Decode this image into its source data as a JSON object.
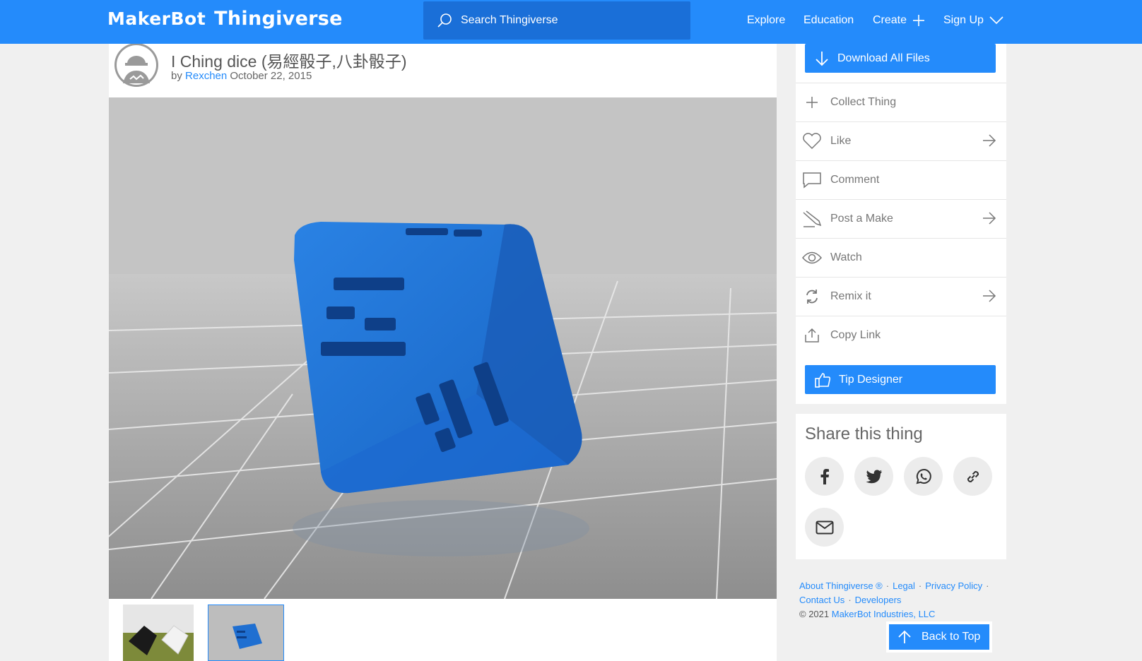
{
  "brand": {
    "maker": "MakerBot",
    "thingiverse": "Thingiverse"
  },
  "search": {
    "placeholder": "Search Thingiverse"
  },
  "nav": {
    "explore": "Explore",
    "education": "Education",
    "create": "Create",
    "signup": "Sign Up"
  },
  "thing": {
    "title": "I Ching dice (易經骰子,八卦骰子)",
    "by": "by",
    "author": "Rexchen",
    "date": "October 22, 2015"
  },
  "actions": {
    "download": "Download All Files",
    "collect": "Collect Thing",
    "like": "Like",
    "comment": "Comment",
    "post_make": "Post a Make",
    "watch": "Watch",
    "remix": "Remix it",
    "copy_link": "Copy Link",
    "tip": "Tip Designer"
  },
  "share": {
    "title": "Share this thing",
    "icons": [
      "facebook-icon",
      "twitter-icon",
      "whatsapp-icon",
      "link-icon",
      "email-icon"
    ]
  },
  "footer": {
    "about": "About Thingiverse ®",
    "legal": "Legal",
    "privacy": "Privacy Policy",
    "contact": "Contact Us",
    "developers": "Developers",
    "copyright": "©  2021",
    "company": "MakerBot Industries, LLC",
    "back_to_top": "Back to Top"
  },
  "colors": {
    "brand_blue": "#248bfb",
    "search_bg": "#1a6fd8",
    "model_blue": "#1f6fd1"
  }
}
